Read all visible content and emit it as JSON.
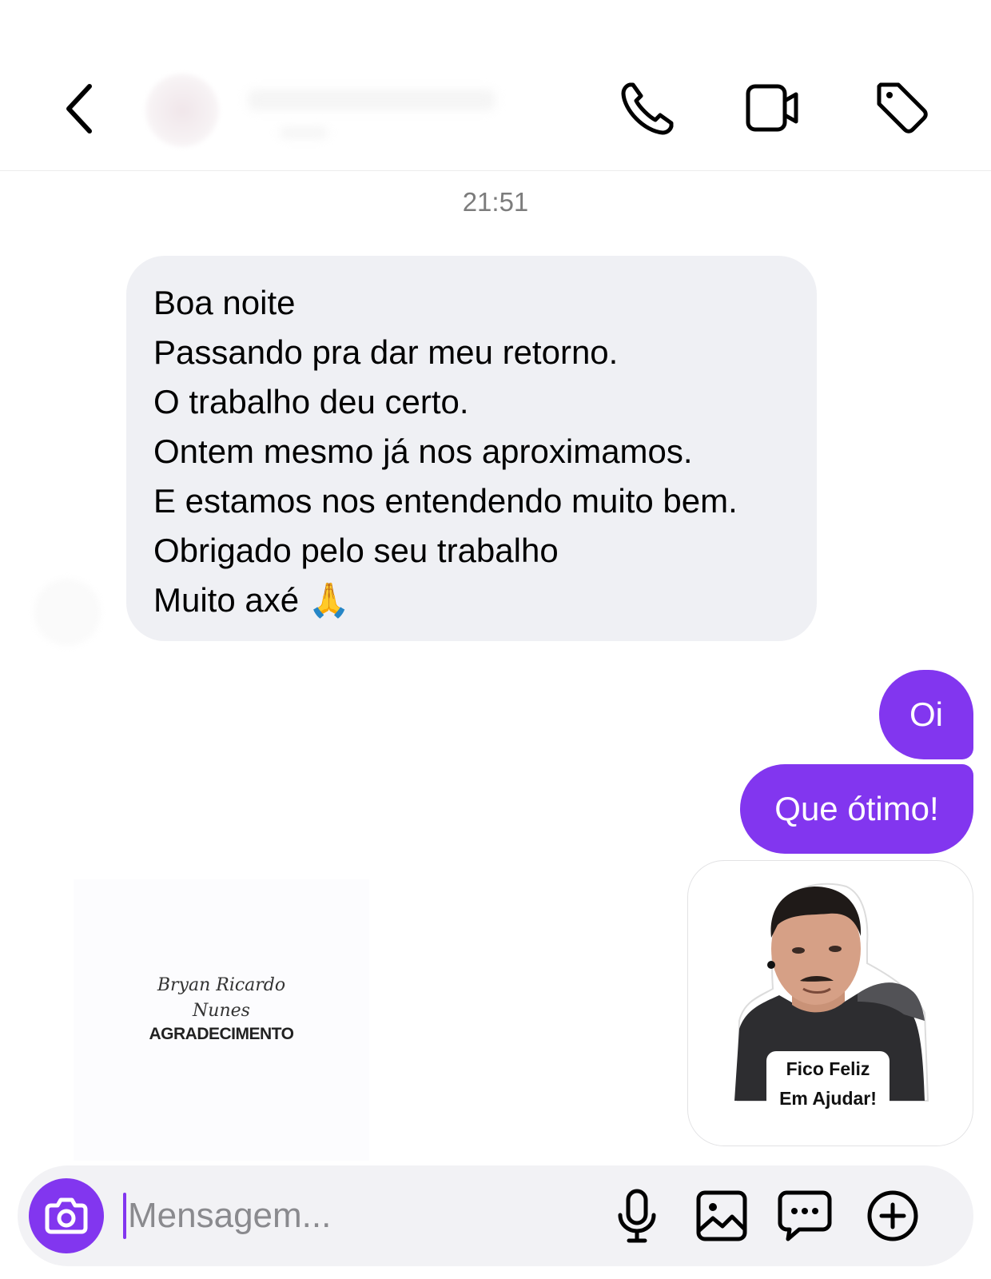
{
  "conversation": {
    "timestamp": "21:51",
    "incoming_message": {
      "lines": [
        "Boa noite",
        "Passando pra dar meu retorno.",
        "O trabalho deu certo.",
        "Ontem mesmo já nos aproximamos.",
        "E estamos nos entendendo muito bem.",
        "Obrigado pelo seu trabalho",
        "Muito axé"
      ],
      "emoji": "🙏"
    },
    "outgoing_messages": [
      {
        "text": "Oi"
      },
      {
        "text": "Que ótimo!"
      }
    ],
    "logo_image": {
      "script_line1": "Bryan Ricardo",
      "script_line2": "Nunes",
      "bold_line": "AGRADECIMENTO"
    },
    "sticker": {
      "caption_line1": "Fico Feliz",
      "caption_line2": "Em Ajudar!"
    }
  },
  "header": {
    "icons": [
      "chevron-left-icon",
      "phone-icon",
      "video-camera-icon",
      "tag-icon"
    ]
  },
  "composer": {
    "placeholder": "Mensagem...",
    "icons": [
      "camera-icon",
      "microphone-icon",
      "image-icon",
      "chat-bubble-icon",
      "plus-circle-icon"
    ]
  },
  "colors": {
    "accent": "#8236ef",
    "incoming_bubble": "#eff0f4",
    "timestamp_text": "#7c7c7c"
  }
}
